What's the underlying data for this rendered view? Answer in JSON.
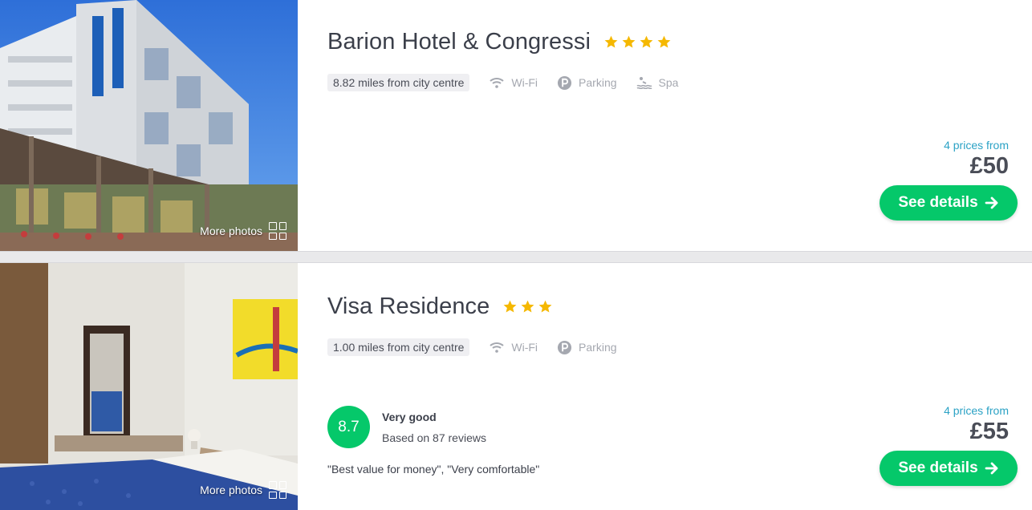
{
  "listings": [
    {
      "name": "Barion Hotel & Congressi",
      "star_count": 4,
      "distance": "8.82 miles from city centre",
      "amenities": [
        "Wi-Fi",
        "Parking",
        "Spa"
      ],
      "prices_from": "4 prices from",
      "price": "£50",
      "cta": "See details",
      "more_photos": "More photos"
    },
    {
      "name": "Visa Residence",
      "star_count": 3,
      "distance": "1.00 miles from city centre",
      "amenities": [
        "Wi-Fi",
        "Parking"
      ],
      "rating": {
        "score": "8.7",
        "label": "Very good",
        "reviews": "Based on 87 reviews",
        "quote": "\"Best value for money\", \"Very comfortable\""
      },
      "prices_from": "4 prices from",
      "price": "£55",
      "cta": "See details",
      "more_photos": "More photos"
    }
  ],
  "colors": {
    "accent_green": "#05c86a",
    "star_gold": "#f5b800",
    "link_blue": "#2ba2c5",
    "amenity_grey": "#a5a8b0"
  },
  "icons": {
    "wifi": "wifi-icon",
    "parking": "parking-icon",
    "spa": "spa-icon",
    "star": "star-icon",
    "arrow": "arrow-right-icon",
    "gallery": "gallery-grid-icon"
  }
}
